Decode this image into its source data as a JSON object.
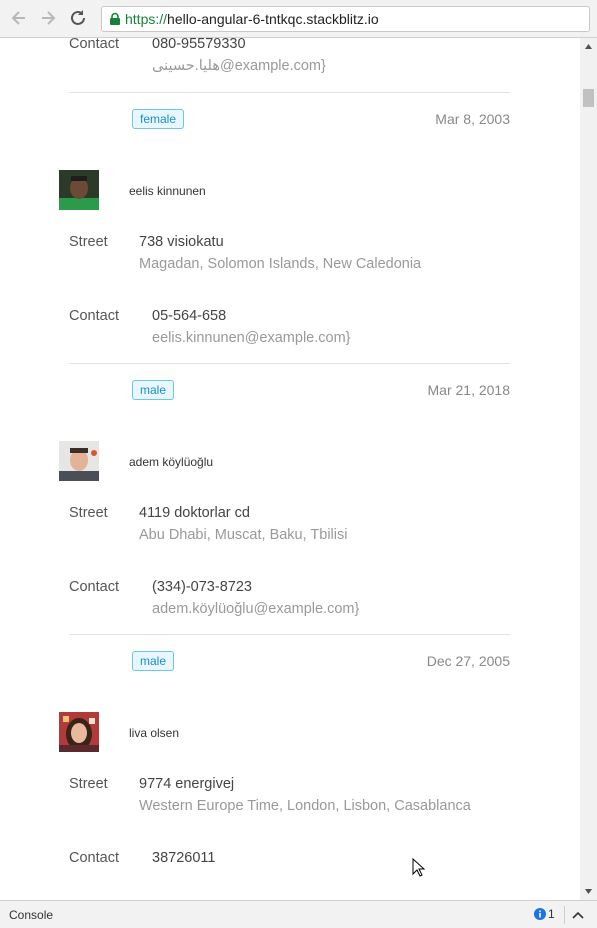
{
  "browser": {
    "url_scheme": "https://",
    "url_host": "hello-angular-6-tntkqc.stackblitz.io"
  },
  "labels": {
    "street": "Street",
    "contact": "Contact"
  },
  "partial_top": {
    "phone": "080-95579330",
    "email": "هلیا.حسینی@example.com}",
    "gender": "female",
    "date": "Mar 8, 2003"
  },
  "people": [
    {
      "name": "eelis kinnunen",
      "street": "738 visiokatu",
      "location": "Magadan, Solomon Islands, New Caledonia",
      "phone": "05-564-658",
      "email": "eelis.kinnunen@example.com}",
      "gender": "male",
      "date": "Mar 21, 2018"
    },
    {
      "name": "adem köylüoğlu",
      "street": "4119 doktorlar cd",
      "location": "Abu Dhabi, Muscat, Baku, Tbilisi",
      "phone": "(334)-073-8723",
      "email": "adem.köylüoğlu@example.com}",
      "gender": "male",
      "date": "Dec 27, 2005"
    },
    {
      "name": "liva olsen",
      "street": "9774 energivej",
      "location": "Western Europe Time, London, Lisbon, Casablanca",
      "phone": "38726011"
    }
  ],
  "console": {
    "label": "Console",
    "count": "1"
  }
}
